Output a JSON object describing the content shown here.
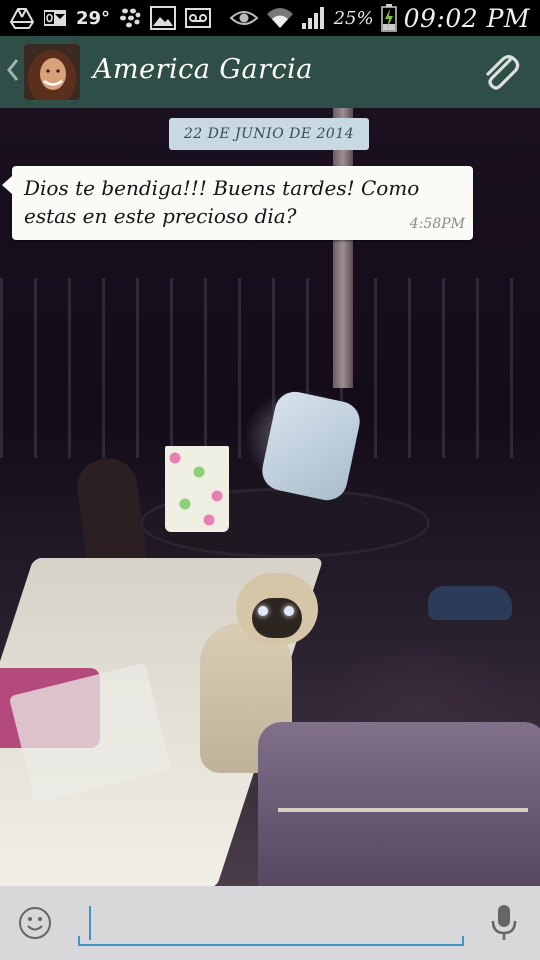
{
  "status_bar": {
    "temperature": "29°",
    "battery_percent": "25%",
    "time": "09:02 PM",
    "icons": [
      "drive-icon",
      "outlook-mail-icon",
      "blackberry-messenger-icon",
      "gallery-icon",
      "voicemail-icon",
      "eye-icon",
      "wifi-icon",
      "signal-icon",
      "battery-charging-icon"
    ]
  },
  "header": {
    "contact_name": "America Garcia",
    "back_icon": "chevron-left-icon",
    "attach_icon": "paperclip-icon",
    "colors": {
      "bar": "#304e48",
      "text": "#ffffff"
    }
  },
  "chat": {
    "date_label": "22 DE JUNIO DE 2014",
    "messages": [
      {
        "direction": "incoming",
        "text": "Dios te bendiga!!! Buens tardes! Como estas en este precioso dia?",
        "time": "4:58PM"
      }
    ]
  },
  "input_bar": {
    "emoji_icon": "smiley-icon",
    "mic_icon": "microphone-icon",
    "text_value": "",
    "accent_color": "#3a96c6"
  }
}
